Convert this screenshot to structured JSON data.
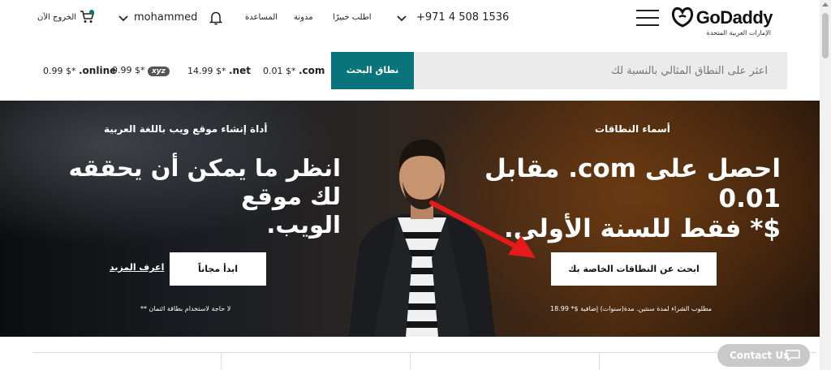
{
  "header": {
    "logo_text": "GoDaddy",
    "logo_subtitle": "الإمارات العربية المتحدة",
    "phone": "+971 4 508 1536",
    "hire_expert": "اطلب خبيرًا",
    "blog": "مدونة",
    "help": "المساعدة",
    "username": "mohammed",
    "sign_out": "الخروج الآن"
  },
  "search": {
    "placeholder": "اعثر على النطاق المثالي بالنسبة لك",
    "button_label": "نطاق البحث",
    "tlds": [
      {
        "name": ".com",
        "price": "0.01 $*"
      },
      {
        "name": ".net",
        "price": "14.99 $*"
      },
      {
        "name": "xyz",
        "price": "0.99 $*"
      },
      {
        "name": ".online",
        "price": "0.99 $*"
      }
    ]
  },
  "hero": {
    "right": {
      "eyebrow": "أسماء النطاقات",
      "headline_line1": "احصل على com. مقابل 0.01",
      "headline_line2": "$* فقط للسنة الأولى.",
      "cta": "ابحث عن النطاقات الخاصة بك",
      "fineprint": "مطلوب الشراء لمدة سنتين. مدة(سنوات) إضافية $* 18.99"
    },
    "left": {
      "eyebrow": "أداة إنشاء موقع ويب باللغة العربية",
      "headline_line1": "انظر ما يمكن أن يحققه لك موقع",
      "headline_line2": "الويب.",
      "cta": "ابدأ مجاناً",
      "learn_more": "اعرف المزيد",
      "fineprint": "لا حاجة لاستخدام بطاقة ائتمان **"
    }
  },
  "contact": {
    "label": "Contact Us"
  },
  "colors": {
    "teal": "#09757a",
    "hero_dark": "#0c0d0f",
    "hero_warm": "#4a2a10"
  }
}
